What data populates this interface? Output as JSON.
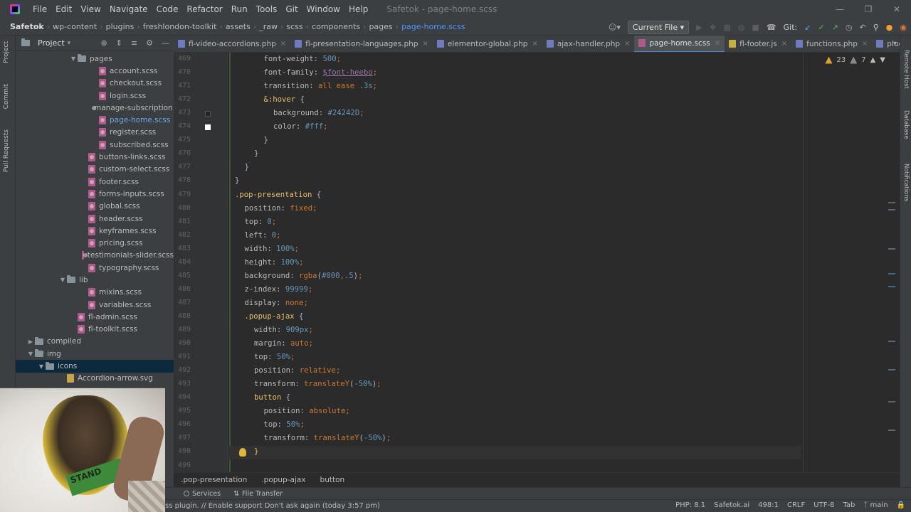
{
  "menubar": {
    "items": [
      "File",
      "Edit",
      "View",
      "Navigate",
      "Code",
      "Refactor",
      "Run",
      "Tools",
      "Git",
      "Window",
      "Help"
    ],
    "title": "Safetok - page-home.scss"
  },
  "navbar": {
    "breadcrumbs": [
      "Safetok",
      "wp-content",
      "plugins",
      "freshlondon-toolkit",
      "assets",
      "_raw",
      "scss",
      "components",
      "pages",
      "page-home.scss"
    ],
    "run_config": "Current File",
    "git_label": "Git:"
  },
  "left_stripe": [
    "Project",
    "Commit",
    "Pull Requests"
  ],
  "project": {
    "title": "Project",
    "tree": [
      {
        "label": "pages",
        "type": "folder",
        "indent": 5,
        "open": true
      },
      {
        "label": "account.scss",
        "type": "scss",
        "indent": 7
      },
      {
        "label": "checkout.scss",
        "type": "scss",
        "indent": 7
      },
      {
        "label": "login.scss",
        "type": "scss",
        "indent": 7
      },
      {
        "label": "manage-subscription.scss",
        "type": "scss",
        "indent": 7
      },
      {
        "label": "page-home.scss",
        "type": "scss",
        "indent": 7,
        "active": true
      },
      {
        "label": "register.scss",
        "type": "scss",
        "indent": 7
      },
      {
        "label": "subscribed.scss",
        "type": "scss",
        "indent": 7
      },
      {
        "label": "buttons-links.scss",
        "type": "scss",
        "indent": 6
      },
      {
        "label": "custom-select.scss",
        "type": "scss",
        "indent": 6
      },
      {
        "label": "footer.scss",
        "type": "scss",
        "indent": 6
      },
      {
        "label": "forms-inputs.scss",
        "type": "scss",
        "indent": 6
      },
      {
        "label": "global.scss",
        "type": "scss",
        "indent": 6
      },
      {
        "label": "header.scss",
        "type": "scss",
        "indent": 6
      },
      {
        "label": "keyframes.scss",
        "type": "scss",
        "indent": 6
      },
      {
        "label": "pricing.scss",
        "type": "scss",
        "indent": 6
      },
      {
        "label": "testimonials-slider.scss",
        "type": "scss",
        "indent": 6
      },
      {
        "label": "typography.scss",
        "type": "scss",
        "indent": 6
      },
      {
        "label": "lib",
        "type": "folder",
        "indent": 4,
        "open": true
      },
      {
        "label": "mixins.scss",
        "type": "scss",
        "indent": 6
      },
      {
        "label": "variables.scss",
        "type": "scss",
        "indent": 6
      },
      {
        "label": "fl-admin.scss",
        "type": "scss",
        "indent": 5
      },
      {
        "label": "fl-toolkit.scss",
        "type": "scss",
        "indent": 5
      },
      {
        "label": "compiled",
        "type": "folder",
        "indent": 1,
        "open": false
      },
      {
        "label": "img",
        "type": "folder",
        "indent": 1,
        "open": true
      },
      {
        "label": "icons",
        "type": "folder",
        "indent": 2,
        "open": true,
        "selected": true
      },
      {
        "label": "Accordion-arrow.svg",
        "type": "svg",
        "indent": 4
      }
    ]
  },
  "webcam": {
    "shirt_text": "STAND"
  },
  "tabs": [
    {
      "label": "fl-video-accordions.php",
      "kind": "php"
    },
    {
      "label": "fl-presentation-languages.php",
      "kind": "php"
    },
    {
      "label": "elementor-global.php",
      "kind": "php"
    },
    {
      "label": "ajax-handler.php",
      "kind": "php"
    },
    {
      "label": "page-home.scss",
      "kind": "scss",
      "active": true
    },
    {
      "label": "fl-footer.js",
      "kind": "js"
    },
    {
      "label": "functions.php",
      "kind": "php"
    },
    {
      "label": "plugin.php",
      "kind": "php"
    }
  ],
  "right_stripe": [
    "Remote Host",
    "Database",
    "Notifications"
  ],
  "editor": {
    "warnings": "23",
    "weak_warnings": "7",
    "lines": [
      {
        "n": "469",
        "indent": 3,
        "tokens": [
          [
            "p",
            "font-weight"
          ],
          [
            "x",
            ": "
          ],
          [
            "n",
            "500"
          ],
          [
            "c",
            ";"
          ]
        ]
      },
      {
        "n": "470",
        "indent": 3,
        "tokens": [
          [
            "p",
            "font-family"
          ],
          [
            "x",
            ": "
          ],
          [
            "v",
            "$font-heebo"
          ],
          [
            "c",
            ";"
          ]
        ]
      },
      {
        "n": "471",
        "indent": 3,
        "tokens": [
          [
            "p",
            "transition"
          ],
          [
            "x",
            ": "
          ],
          [
            "k",
            "all ease "
          ],
          [
            "n",
            ".3s"
          ],
          [
            "c",
            ";"
          ]
        ]
      },
      {
        "n": "472",
        "indent": 3,
        "tokens": [
          [
            "s",
            "&:hover"
          ],
          [
            "x",
            " {"
          ]
        ]
      },
      {
        "n": "473",
        "indent": 4,
        "tokens": [
          [
            "p",
            "background"
          ],
          [
            "x",
            ": "
          ],
          [
            "n",
            "#24242D"
          ],
          [
            "c",
            ";"
          ]
        ]
      },
      {
        "n": "474",
        "indent": 4,
        "tokens": [
          [
            "p",
            "color"
          ],
          [
            "x",
            ": "
          ],
          [
            "n",
            "#fff"
          ],
          [
            "c",
            ";"
          ]
        ]
      },
      {
        "n": "475",
        "indent": 3,
        "tokens": [
          [
            "x",
            "}"
          ]
        ]
      },
      {
        "n": "476",
        "indent": 2,
        "tokens": [
          [
            "x",
            "}"
          ]
        ]
      },
      {
        "n": "477",
        "indent": 1,
        "tokens": [
          [
            "x",
            "}"
          ]
        ]
      },
      {
        "n": "478",
        "indent": 0,
        "tokens": [
          [
            "x",
            "}"
          ]
        ]
      },
      {
        "n": "479",
        "indent": 0,
        "tokens": [
          [
            "s",
            ".pop-presentation"
          ],
          [
            "x",
            " {"
          ]
        ]
      },
      {
        "n": "480",
        "indent": 1,
        "tokens": [
          [
            "p",
            "position"
          ],
          [
            "x",
            ": "
          ],
          [
            "k",
            "fixed"
          ],
          [
            "c",
            ";"
          ]
        ]
      },
      {
        "n": "481",
        "indent": 1,
        "tokens": [
          [
            "p",
            "top"
          ],
          [
            "x",
            ": "
          ],
          [
            "n",
            "0"
          ],
          [
            "c",
            ";"
          ]
        ]
      },
      {
        "n": "482",
        "indent": 1,
        "tokens": [
          [
            "p",
            "left"
          ],
          [
            "x",
            ": "
          ],
          [
            "n",
            "0"
          ],
          [
            "c",
            ";"
          ]
        ]
      },
      {
        "n": "483",
        "indent": 1,
        "tokens": [
          [
            "p",
            "width"
          ],
          [
            "x",
            ": "
          ],
          [
            "n",
            "100%"
          ],
          [
            "c",
            ";"
          ]
        ]
      },
      {
        "n": "484",
        "indent": 1,
        "tokens": [
          [
            "p",
            "height"
          ],
          [
            "x",
            ": "
          ],
          [
            "n",
            "100%"
          ],
          [
            "c",
            ";"
          ]
        ]
      },
      {
        "n": "485",
        "indent": 1,
        "tokens": [
          [
            "p",
            "background"
          ],
          [
            "x",
            ": "
          ],
          [
            "k",
            "rgba"
          ],
          [
            "x",
            "("
          ],
          [
            "n",
            "#000"
          ],
          [
            "c",
            ","
          ],
          [
            "n",
            ".5"
          ],
          [
            "x",
            ")"
          ],
          [
            "c",
            ";"
          ]
        ]
      },
      {
        "n": "486",
        "indent": 1,
        "tokens": [
          [
            "p",
            "z-index"
          ],
          [
            "x",
            ": "
          ],
          [
            "n",
            "99999"
          ],
          [
            "c",
            ";"
          ]
        ]
      },
      {
        "n": "487",
        "indent": 1,
        "tokens": [
          [
            "p",
            "display"
          ],
          [
            "x",
            ": "
          ],
          [
            "k",
            "none"
          ],
          [
            "c",
            ";"
          ]
        ]
      },
      {
        "n": "488",
        "indent": 1,
        "tokens": [
          [
            "s",
            ".popup-ajax"
          ],
          [
            "x",
            " {"
          ]
        ]
      },
      {
        "n": "489",
        "indent": 2,
        "tokens": [
          [
            "p",
            "width"
          ],
          [
            "x",
            ": "
          ],
          [
            "n",
            "909px"
          ],
          [
            "c",
            ";"
          ]
        ]
      },
      {
        "n": "490",
        "indent": 2,
        "tokens": [
          [
            "p",
            "margin"
          ],
          [
            "x",
            ": "
          ],
          [
            "k",
            "auto"
          ],
          [
            "c",
            ";"
          ]
        ]
      },
      {
        "n": "491",
        "indent": 2,
        "tokens": [
          [
            "p",
            "top"
          ],
          [
            "x",
            ": "
          ],
          [
            "n",
            "50%"
          ],
          [
            "c",
            ";"
          ]
        ]
      },
      {
        "n": "492",
        "indent": 2,
        "tokens": [
          [
            "p",
            "position"
          ],
          [
            "x",
            ": "
          ],
          [
            "k",
            "relative"
          ],
          [
            "c",
            ";"
          ]
        ]
      },
      {
        "n": "493",
        "indent": 2,
        "tokens": [
          [
            "p",
            "transform"
          ],
          [
            "x",
            ": "
          ],
          [
            "k",
            "translateY"
          ],
          [
            "x",
            "("
          ],
          [
            "n",
            "-50%"
          ],
          [
            "x",
            ")"
          ],
          [
            "c",
            ";"
          ]
        ]
      },
      {
        "n": "494",
        "indent": 2,
        "tokens": [
          [
            "s",
            "button"
          ],
          [
            "x",
            " {"
          ]
        ]
      },
      {
        "n": "495",
        "indent": 3,
        "tokens": [
          [
            "p",
            "position"
          ],
          [
            "x",
            ": "
          ],
          [
            "k",
            "absolute"
          ],
          [
            "c",
            ";"
          ]
        ]
      },
      {
        "n": "496",
        "indent": 3,
        "tokens": [
          [
            "p",
            "top"
          ],
          [
            "x",
            ": "
          ],
          [
            "n",
            "50%"
          ],
          [
            "c",
            ";"
          ]
        ]
      },
      {
        "n": "497",
        "indent": 3,
        "tokens": [
          [
            "p",
            "transform"
          ],
          [
            "x",
            ": "
          ],
          [
            "k",
            "translateY"
          ],
          [
            "x",
            "("
          ],
          [
            "n",
            "-50%"
          ],
          [
            "x",
            ")"
          ],
          [
            "c",
            ";"
          ]
        ]
      },
      {
        "n": "498",
        "indent": 2,
        "tokens": [
          [
            "s",
            "}"
          ]
        ]
      },
      {
        "n": "499",
        "indent": 0,
        "tokens": []
      }
    ]
  },
  "editor_crumbs": [
    ".pop-presentation",
    ".popup-ajax",
    "button"
  ],
  "tool_tabs": [
    "Services",
    "File Transfer"
  ],
  "status": {
    "message": "ss plugin. // Enable support   Don't ask again (today 3:57 pm)",
    "php": "PHP: 8.1",
    "host": "Safetok.ai",
    "position": "498:1",
    "line_sep": "CRLF",
    "encoding": "UTF-8",
    "indent": "Tab",
    "branch": "main"
  },
  "colors": {
    "accent": "#4a88c7",
    "selection": "#0d293e",
    "swatch_dark": "#24242D",
    "swatch_white": "#ffffff"
  }
}
